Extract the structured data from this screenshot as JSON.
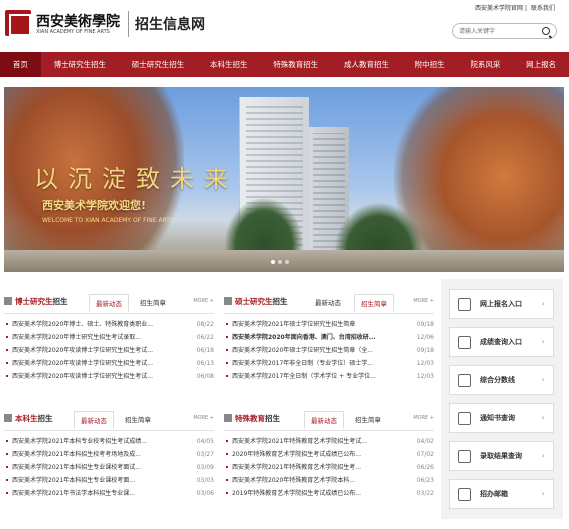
{
  "header": {
    "logo_name": "西安美術學院",
    "logo_en": "XIAN ACADEMY OF FINE ARTS",
    "site_title": "招生信息网",
    "top_links": [
      "西安美术学院官网",
      "联系我们"
    ],
    "search_placeholder": "请输入关键字"
  },
  "nav": [
    "首页",
    "博士研究生招生",
    "硕士研究生招生",
    "本科生招生",
    "特殊教育招生",
    "成人教育招生",
    "附中招生",
    "院系风采",
    "网上报名"
  ],
  "banner": {
    "slogan": "以沉淀致未来",
    "welcome": "西安美术学院欢迎您!",
    "welcome_en": "WELCOME TO XIAN ACADEMY OF FINE ARTS"
  },
  "panels": {
    "phd": {
      "title_red": "博士研究生",
      "title_rest": "招生",
      "tabs": [
        "最新动态",
        "招生简章"
      ],
      "more": "MORE +",
      "items": [
        {
          "t": "西安美术学院2020年博士、硕士、特殊教育类职业...",
          "d": "08/22"
        },
        {
          "t": "西安美术学院2020年博士研究生招生考试录取...",
          "d": "06/22"
        },
        {
          "t": "西安美术学院2020年攻读博士学位研究生招生考试...",
          "d": "06/18"
        },
        {
          "t": "西安美术学院2020年攻读博士学位研究生招生考试...",
          "d": "06/13"
        },
        {
          "t": "西安美术学院2020年攻读博士学位研究生招生考试...",
          "d": "06/08"
        }
      ]
    },
    "master": {
      "title_red": "硕士研究生",
      "title_rest": "招生",
      "tabs": [
        "最新动态",
        "招生简章"
      ],
      "more": "MORE +",
      "items": [
        {
          "t": "西安美术学院2021年硕士学位研究生招生简章",
          "d": "09/18"
        },
        {
          "t": "西安美术学院2020年面向香港、澳门、台湾招收研...",
          "d": "12/06"
        },
        {
          "t": "西安美术学院2020年硕士学位研究生招生简章（全...",
          "d": "09/18"
        },
        {
          "t": "西安美术学院2017年非全日制（专业学位）硕士学...",
          "d": "12/03"
        },
        {
          "t": "西安美术学院2017年全日制（学术学位 + 专业学位...",
          "d": "12/03"
        }
      ]
    },
    "undergrad": {
      "title_red": "本科生",
      "title_rest": "招生",
      "tabs": [
        "最新动态",
        "招生简章"
      ],
      "more": "MORE +",
      "items": [
        {
          "t": "西安美术学院2021年本科专业校考招生考试成绩...",
          "d": "04/05"
        },
        {
          "t": "西安美术学院2021年本科招生校考考场地及成...",
          "d": "03/27"
        },
        {
          "t": "西安美术学院2021年本科招生专业课校考面试...",
          "d": "03/09"
        },
        {
          "t": "西安美术学院2021年本科招生专业课校考面...",
          "d": "03/03"
        },
        {
          "t": "西安美术学院2021年书法学本科招生专业课...",
          "d": "03/06"
        }
      ]
    },
    "special": {
      "title_red": "特殊教育",
      "title_rest": "招生",
      "tabs": [
        "最新动态",
        "招生简章"
      ],
      "more": "MORE +",
      "items": [
        {
          "t": "西安美术学院2021年特殊教育艺术学院招生考试...",
          "d": "04/02"
        },
        {
          "t": "2020年特殊教育艺术学院招生考试成绩已公布...",
          "d": "07/02"
        },
        {
          "t": "西安美术学院2021年特殊教育艺术学院招生考...",
          "d": "06/26"
        },
        {
          "t": "西安美术学院2020年特殊教育艺术学院本科...",
          "d": "06/23"
        },
        {
          "t": "2019年特殊教育艺术学院招生考试成绩已公布...",
          "d": "03/22"
        }
      ]
    }
  },
  "sidebar": [
    "网上报名入口",
    "成绩查询入口",
    "综合分数线",
    "通知书查询",
    "录取结果查询",
    "招办邮箱"
  ]
}
